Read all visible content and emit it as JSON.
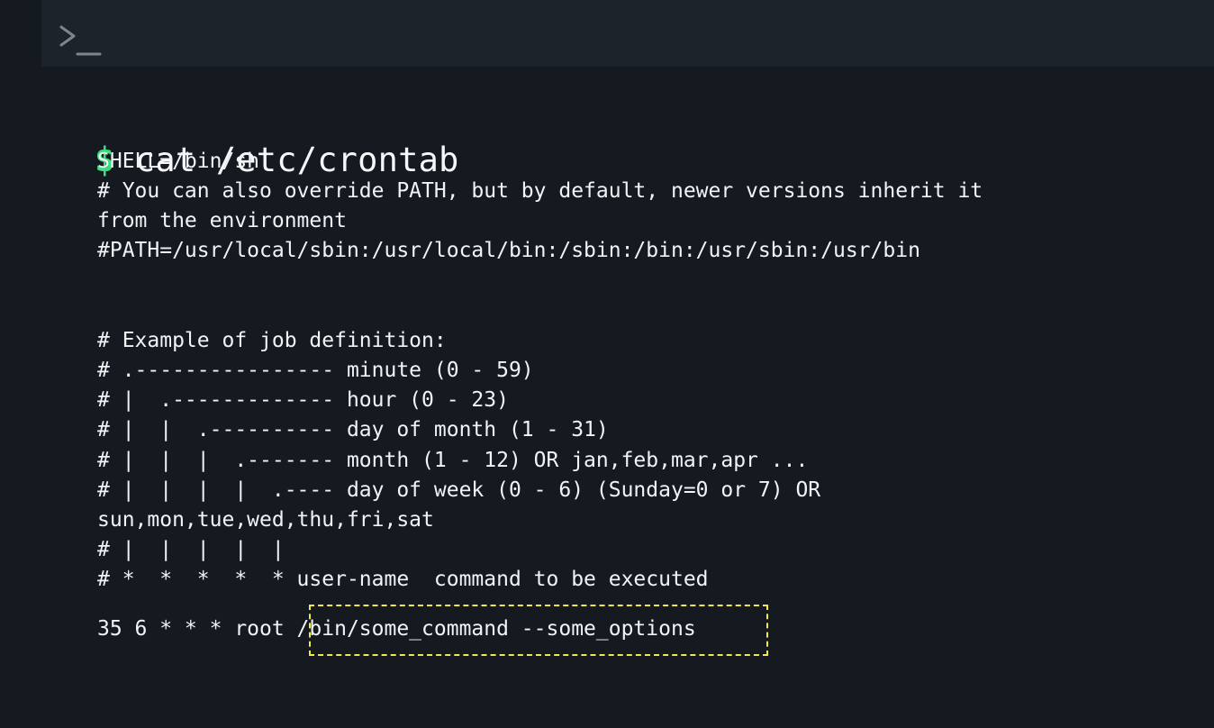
{
  "terminal": {
    "prompt_icon": "terminal-prompt-icon",
    "prompt_symbol": "$",
    "command": "cat /etc/crontab"
  },
  "output": {
    "lines": [
      "SHELL=/bin/sh",
      "# You can also override PATH, but by default, newer versions inherit it",
      "from the environment",
      "#PATH=/usr/local/sbin:/usr/local/bin:/sbin:/bin:/usr/sbin:/usr/bin",
      "# Example of job definition:",
      "# .---------------- minute (0 - 59)",
      "# |  .------------- hour (0 - 23)",
      "# |  |  .---------- day of month (1 - 31)",
      "# |  |  |  .------- month (1 - 12) OR jan,feb,mar,apr ...",
      "# |  |  |  |  .---- day of week (0 - 6) (Sunday=0 or 7) OR",
      "sun,mon,tue,wed,thu,fri,sat",
      "# |  |  |  |  |",
      "# *  *  *  *  * user-name  command to be executed",
      "35 6 * * * root /bin/some_command --some_options"
    ]
  },
  "colors": {
    "background": "#151a21",
    "titlebar": "#1d232b",
    "prompt_symbol": "#3ddc7d",
    "text": "#f1f3f5",
    "highlight_border": "#f0e94b"
  }
}
